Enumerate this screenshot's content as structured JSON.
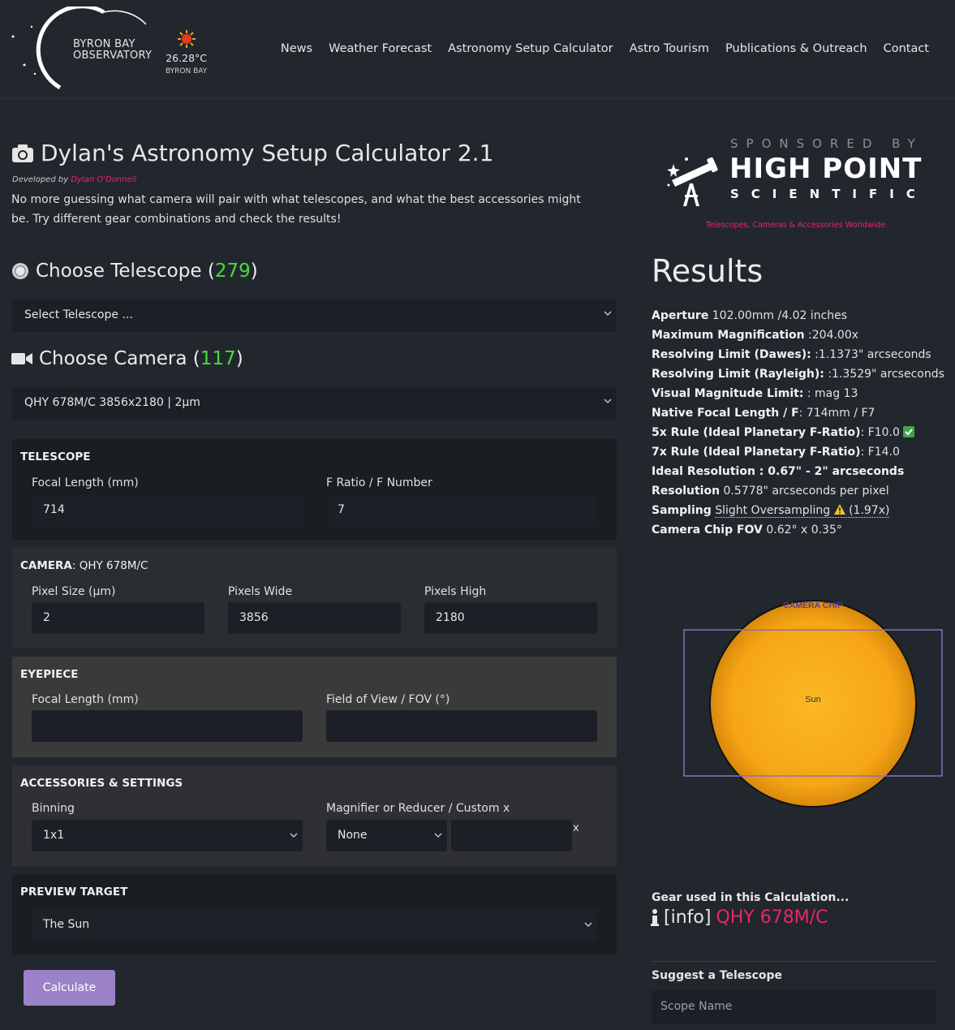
{
  "header": {
    "logo_line1": "BYRON BAY",
    "logo_line2": "OBSERVATORY",
    "weather_temp": "26.28°C",
    "weather_location": "BYRON BAY",
    "nav": [
      "News",
      "Weather Forecast",
      "Astronomy Setup Calculator",
      "Astro Tourism",
      "Publications & Outreach",
      "Contact"
    ]
  },
  "page": {
    "title": "Dylan's Astronomy Setup Calculator 2.1",
    "developed_by": "Developed by",
    "author": "Dylan O'Donnell",
    "intro": "No more guessing what camera will pair with what telescopes, and what the best accessories might be. Try different gear combinations and check the results!"
  },
  "telescope_select": {
    "heading": "Choose Telescope",
    "paren_open": "(",
    "count": "279",
    "paren_close": ")",
    "value": "Select Telescope ..."
  },
  "camera_select": {
    "heading": "Choose Camera",
    "paren_open": "(",
    "count": "117",
    "paren_close": ")",
    "value": "QHY 678M/C 3856x2180 | 2µm"
  },
  "telescope_panel": {
    "heading": "TELESCOPE",
    "focal_label": "Focal Length (mm)",
    "focal_value": "714",
    "fratio_label": "F Ratio / F Number",
    "fratio_value": "7"
  },
  "camera_panel": {
    "heading": "CAMERA",
    "model": ": QHY 678M/C",
    "pixel_size_label": "Pixel Size (µm)",
    "pixel_size_value": "2",
    "pixels_wide_label": "Pixels Wide",
    "pixels_wide_value": "3856",
    "pixels_high_label": "Pixels High",
    "pixels_high_value": "2180"
  },
  "eyepiece_panel": {
    "heading": "EYEPIECE",
    "focal_label": "Focal Length (mm)",
    "fov_label": "Field of View / FOV (°)",
    "focal_value": "",
    "fov_value": ""
  },
  "accessories_panel": {
    "heading": "ACCESSORIES & SETTINGS",
    "binning_label": "Binning",
    "binning_value": "1x1",
    "magnifier_label": "Magnifier or Reducer / Custom x",
    "magnifier_value": "None",
    "custom_value": "",
    "x_suffix": "x"
  },
  "preview_panel": {
    "heading": "PREVIEW TARGET",
    "value": "The Sun"
  },
  "calculate_label": "Calculate",
  "sponsor": {
    "sponsored_by": "SPONSORED BY",
    "brand_line1": "HIGH POINT",
    "brand_line2": "SCIENTIFIC",
    "tagline": "Telescopes, Cameras & Accessories Worldwide"
  },
  "results": {
    "heading": "Results",
    "rows": [
      {
        "label": "Aperture",
        "value": " 102.00mm /4.02 inches"
      },
      {
        "label": "Maximum Magnification",
        "value": " :204.00x"
      },
      {
        "label": "Resolving Limit (Dawes):",
        "value": " :1.1373\" arcseconds"
      },
      {
        "label": "Resolving Limit (Rayleigh):",
        "value": " :1.3529\" arcseconds"
      },
      {
        "label": "Visual Magnitude Limit:",
        "value": " : mag 13"
      },
      {
        "label": "Native Focal Length / F",
        "value": ": 714mm / F7"
      },
      {
        "label": "5x Rule (Ideal Planetary F-Ratio)",
        "value": ": F10.0"
      },
      {
        "label": "7x Rule (Ideal Planetary F-Ratio)",
        "value": ": F14.0"
      },
      {
        "label": "Ideal Resolution : 0.67\" - 2\" arcseconds",
        "value": ""
      },
      {
        "label": "Resolution",
        "value": " 0.5778\" arcseconds per pixel"
      },
      {
        "label": "Sampling",
        "value": ""
      },
      {
        "label": "Camera Chip FOV",
        "value": " 0.62° x 0.35°"
      }
    ],
    "sampling_text": "Slight Oversampling",
    "sampling_ratio": " (1.97x)"
  },
  "preview": {
    "chip_label": "CAMERA CHIP",
    "target_label": "Sun",
    "colors": {
      "sun_edge": "#e89a10",
      "sun_center": "#fbb824",
      "chip_border": "#8a6fbf"
    }
  },
  "gear": {
    "heading": "Gear used in this Calculation...",
    "info_text": "[info]",
    "camera": "QHY 678M/C"
  },
  "suggest": {
    "heading": "Suggest a Telescope",
    "placeholder": "Scope Name"
  },
  "colors": {
    "accent_green": "#4cd93c",
    "accent_pink": "#e8266a",
    "button": "#9b82c8"
  }
}
